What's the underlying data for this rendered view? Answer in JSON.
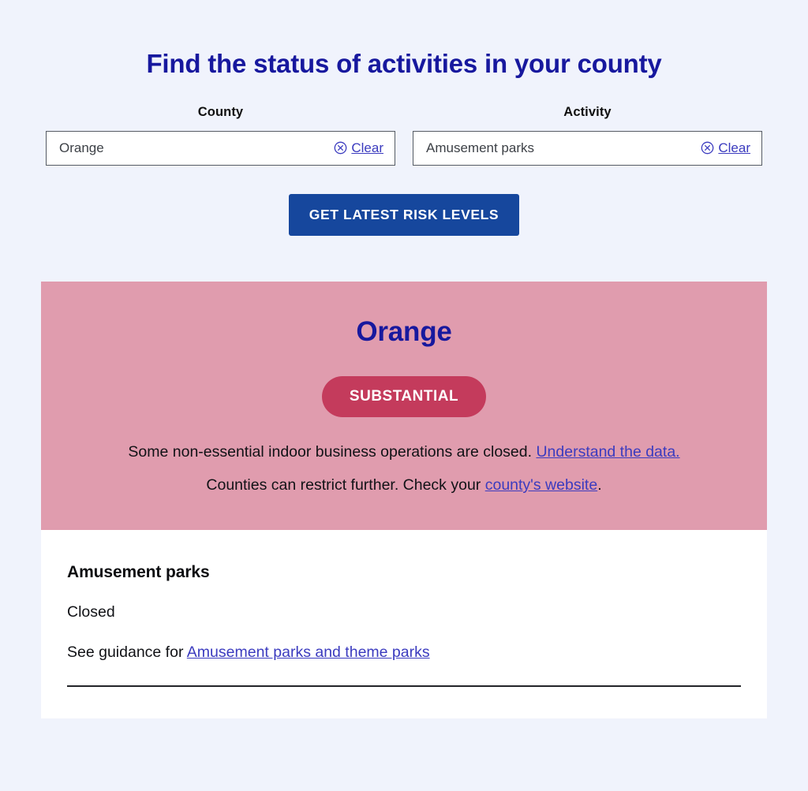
{
  "header": {
    "title": "Find the status of activities in your county"
  },
  "form": {
    "county": {
      "label": "County",
      "value": "Orange",
      "clear_label": "Clear",
      "clear_icon": "circle-x-icon"
    },
    "activity": {
      "label": "Activity",
      "value": "Amusement parks",
      "clear_label": "Clear",
      "clear_icon": "circle-x-icon"
    },
    "submit_label": "GET LATEST RISK LEVELS"
  },
  "result": {
    "county_name": "Orange",
    "risk_level": "SUBSTANTIAL",
    "statement_text": "Some non-essential indoor business operations are closed.",
    "statement_link": "Understand the data.",
    "restriction_prefix": "Counties can restrict further. Check your ",
    "restriction_link": "county's website",
    "restriction_suffix": ".",
    "activity": {
      "title": "Amusement parks",
      "status": "Closed",
      "guidance_prefix": "See guidance for ",
      "guidance_link": "Amusement parks and theme parks"
    }
  },
  "colors": {
    "page_background": "#f0f3fc",
    "title_navy": "#17189e",
    "button_blue": "#16479d",
    "risk_panel_pink": "#e09cae",
    "risk_badge_crimson": "#c43b5c",
    "link_blue": "#3b3bbf"
  }
}
